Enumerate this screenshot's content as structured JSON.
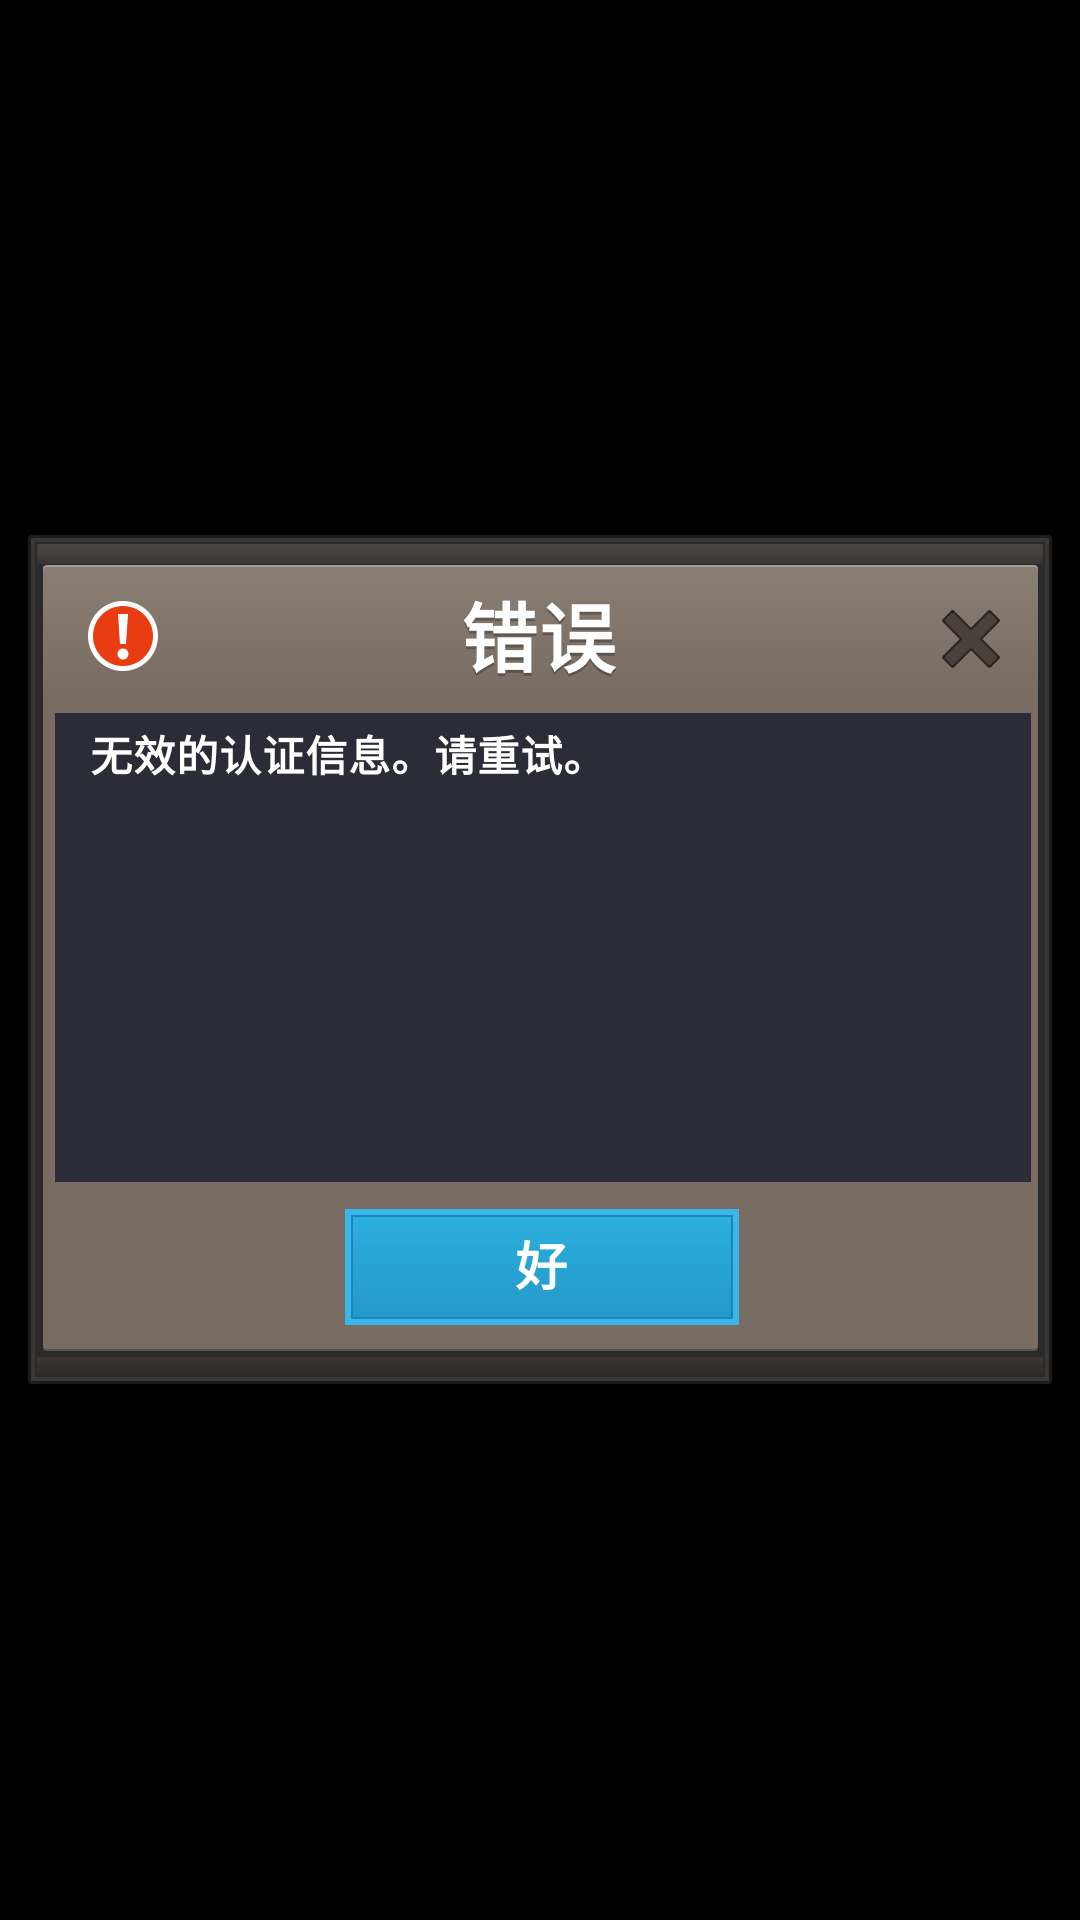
{
  "dialog": {
    "title": "错误",
    "message": "无效的认证信息。请重试。",
    "ok_label": "好",
    "icons": {
      "alert": "exclamation-alert-icon",
      "close": "close-x-icon"
    }
  },
  "colors": {
    "background": "#000000",
    "panel": "#786c62",
    "message_box": "#2c2c38",
    "button": "#2ba6d6",
    "button_border": "#3ab6ea",
    "alert_red": "#ea3c12",
    "close_icon": "#3a322d"
  }
}
